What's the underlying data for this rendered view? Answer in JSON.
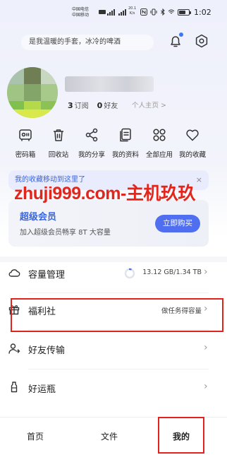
{
  "status_bar": {
    "carrier_1": "中国电信",
    "carrier_2": "中国移动",
    "net_speed_value": "20.1",
    "net_speed_unit": "K/s",
    "time": "1:02",
    "battery_level": 0.7
  },
  "header": {
    "ticker_text": "是我温暖的手套，冰冷的啤酒",
    "bell_icon": "bell-icon",
    "settings_icon": "gear-icon"
  },
  "profile": {
    "follow_count": "3",
    "follow_label": "订阅",
    "friend_count": "0",
    "friend_label": "好友",
    "homepage_label": "个人主页 >"
  },
  "shortcuts": [
    {
      "label": "密码箱",
      "icon": "safe-icon"
    },
    {
      "label": "回收站",
      "icon": "trash-icon"
    },
    {
      "label": "我的分享",
      "icon": "share-icon"
    },
    {
      "label": "我的资料",
      "icon": "document-icon"
    },
    {
      "label": "全部应用",
      "icon": "apps-icon"
    },
    {
      "label": "我的收藏",
      "icon": "heart-icon"
    }
  ],
  "notice": {
    "text": "我的收藏移动到这里了",
    "close": "×"
  },
  "vip": {
    "title": "超级会员",
    "subtitle": "加入超级会员畅享 8T 大容量",
    "buy_label": "立即购买"
  },
  "watermark": "zhuji999.com-主机玖玖",
  "list": {
    "storage": {
      "title": "容量管理",
      "value": "13.12 GB/1.34 TB",
      "usage": 0.01
    },
    "welfare": {
      "title": "福利社",
      "value": "做任务得容量"
    },
    "transfer": {
      "title": "好友传输"
    },
    "lucky": {
      "title": "好运瓶"
    }
  },
  "bottom_nav": {
    "home": "首页",
    "files": "文件",
    "mine": "我的"
  },
  "colors": {
    "accent": "#4f6ff0",
    "highlight": "#e2231a"
  }
}
